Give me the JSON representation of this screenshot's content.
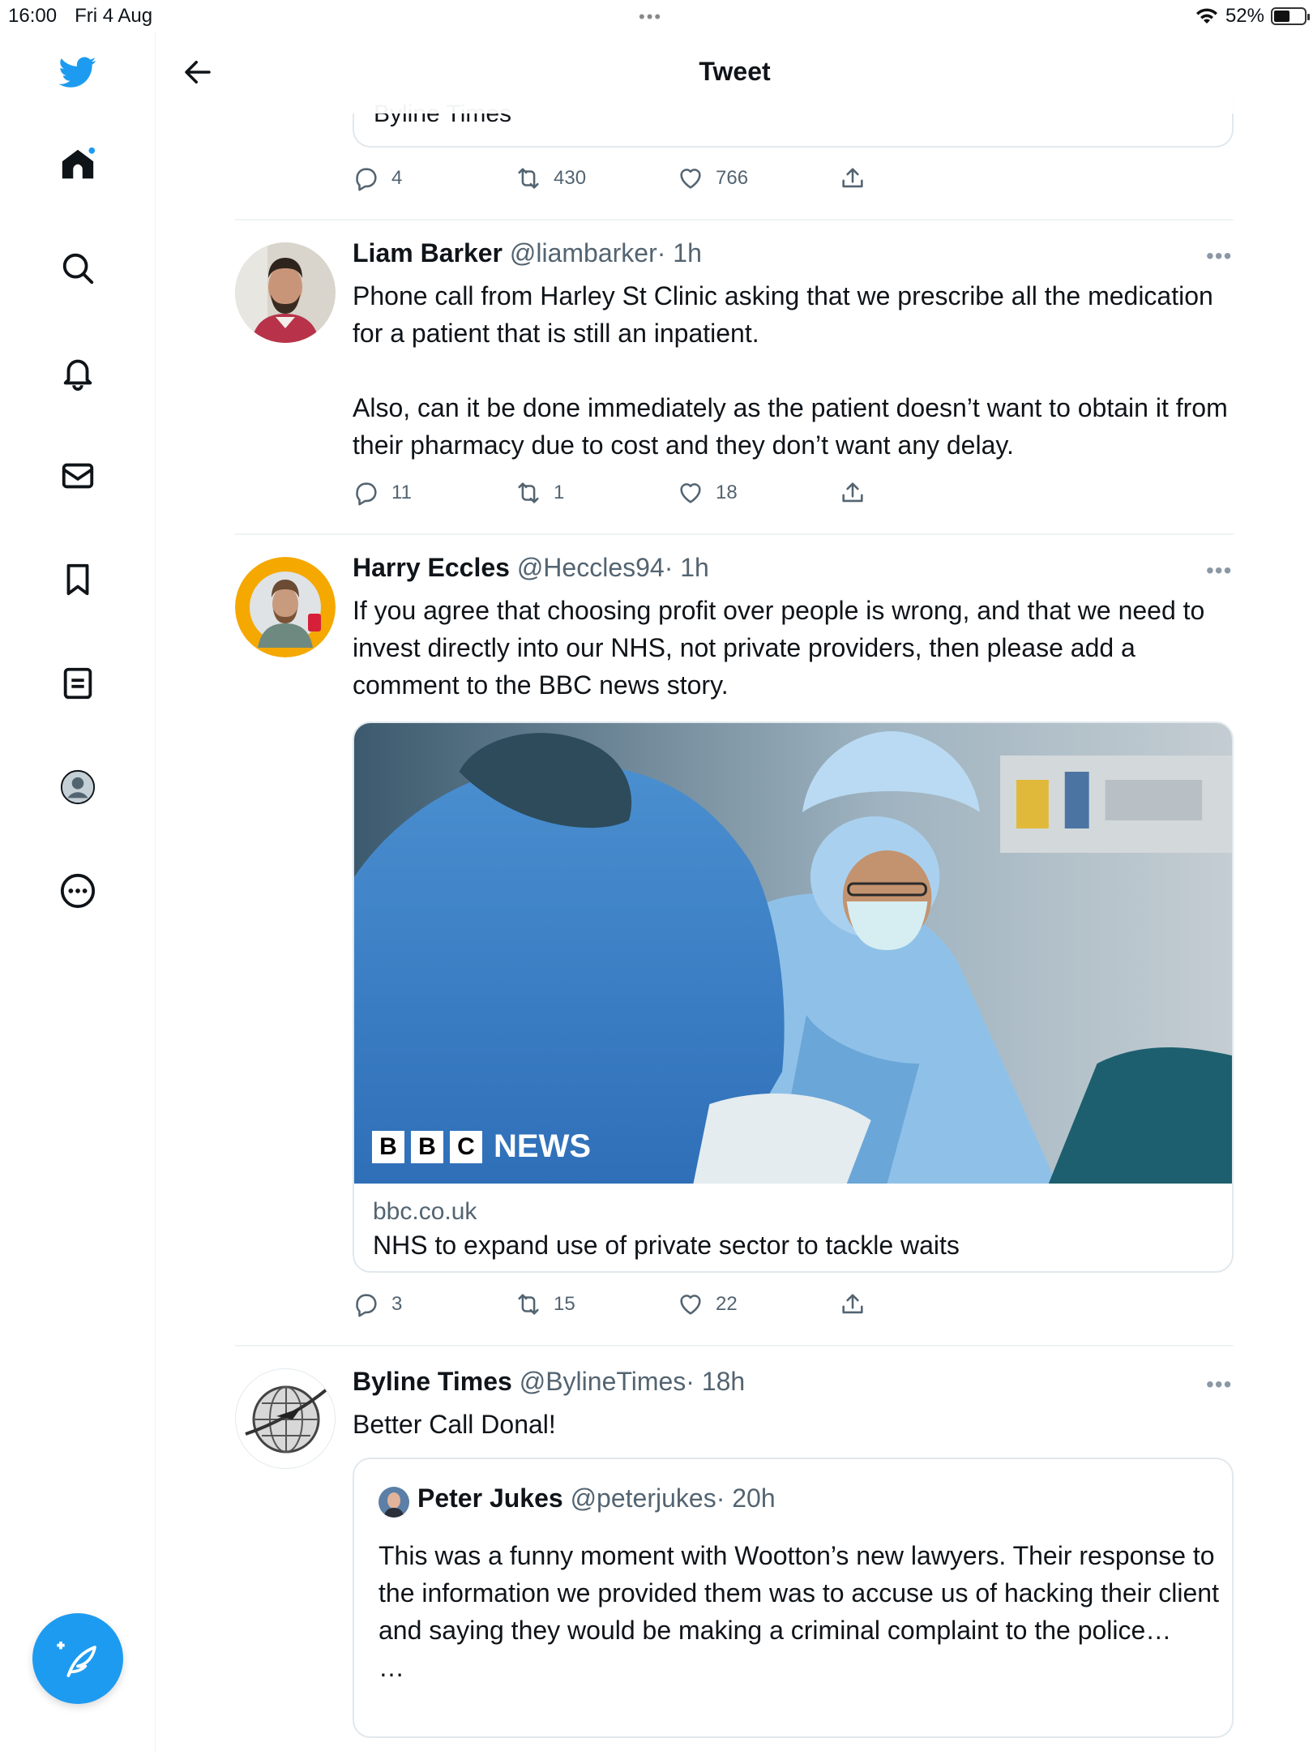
{
  "status_bar": {
    "time": "16:00",
    "date": "Fri 4 Aug",
    "battery": "52%",
    "battery_level": 0.52
  },
  "header": {
    "title": "Tweet"
  },
  "colors": {
    "accent": "#1d9bf0",
    "text": "#0f1419",
    "muted": "#536471"
  },
  "sidebar": {
    "items": [
      {
        "icon": "home-icon"
      },
      {
        "icon": "search-icon"
      },
      {
        "icon": "bell-icon"
      },
      {
        "icon": "mail-icon"
      },
      {
        "icon": "bookmark-icon"
      },
      {
        "icon": "list-icon"
      },
      {
        "icon": "profile-icon"
      },
      {
        "icon": "more-icon"
      }
    ]
  },
  "prev_tweet": {
    "card_label": "Byline Times",
    "actions": {
      "replies": "4",
      "retweets": "430",
      "likes": "766"
    }
  },
  "tweets": [
    {
      "name": "Liam Barker",
      "handle": "@liambarker",
      "time": "· 1h",
      "text": "Phone call from Harley St Clinic asking that we prescribe all the medication for a patient that is still an inpatient.\n\nAlso, can it be done immediately as the patient doesn’t want to obtain it from their pharmacy due to cost and they don’t want any delay.",
      "actions": {
        "replies": "11",
        "retweets": "1",
        "likes": "18"
      }
    },
    {
      "name": "Harry Eccles",
      "handle": "@Heccles94",
      "time": "· 1h",
      "text": "If you agree that choosing profit over people is wrong, and that we need to invest directly into our NHS, not private providers, then please add a comment to the BBC news story.",
      "link": {
        "logo_letters": [
          "B",
          "B",
          "C"
        ],
        "logo_word": "NEWS",
        "domain": "bbc.co.uk",
        "title": "NHS to expand use of private sector to tackle waits"
      },
      "actions": {
        "replies": "3",
        "retweets": "15",
        "likes": "22"
      }
    },
    {
      "name": "Byline Times",
      "handle": "@BylineTimes",
      "time": "· 18h",
      "text": "Better Call Donal!",
      "quote": {
        "name": "Peter Jukes",
        "handle": "@peterjukes",
        "time": "· 20h",
        "text": "This was a funny moment with Wootton’s new lawyers. Their response to the information we provided them was to accuse us of hacking their client and saying they would be making a criminal complaint to the police…\n…"
      }
    }
  ]
}
